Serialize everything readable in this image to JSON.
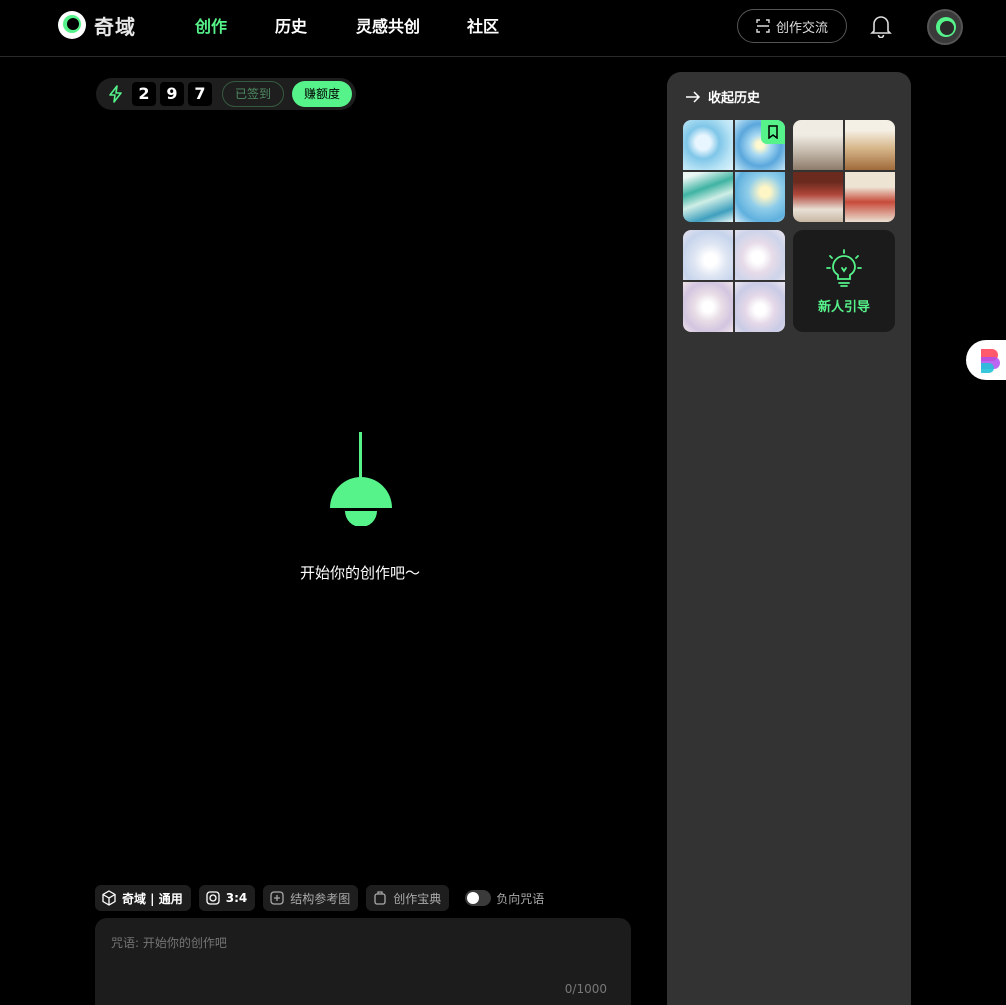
{
  "app": {
    "logo_text": "奇域"
  },
  "nav": {
    "items": [
      {
        "label": "创作",
        "active": true
      },
      {
        "label": "历史",
        "active": false
      },
      {
        "label": "灵感共创",
        "active": false
      },
      {
        "label": "社区",
        "active": false
      }
    ],
    "exchange_label": "创作交流",
    "icons": [
      "scan-icon",
      "bell-icon",
      "avatar"
    ]
  },
  "credits": {
    "digits": [
      "2",
      "9",
      "7"
    ],
    "signed_label": "已签到",
    "earn_label": "赚额度"
  },
  "empty_state": {
    "text": "开始你的创作吧～"
  },
  "toolbar": {
    "model_label": "奇域 | 通用",
    "ratio_label": "3:4",
    "reference_label": "结构参考图",
    "dictionary_label": "创作宝典",
    "negative_label": "负向咒语",
    "negative_enabled": false
  },
  "prompt": {
    "placeholder": "咒语: 开始你的创作吧",
    "value": "",
    "counter": "0/1000"
  },
  "history": {
    "collapse_label": "收起历史",
    "guide_label": "新人引导",
    "items": [
      {
        "bookmarked": true
      },
      {
        "bookmarked": false
      },
      {
        "bookmarked": false
      }
    ]
  },
  "colors": {
    "accent": "#56f38a",
    "background": "#000000",
    "panel": "#333333",
    "input_bg": "#1c1c1c"
  }
}
